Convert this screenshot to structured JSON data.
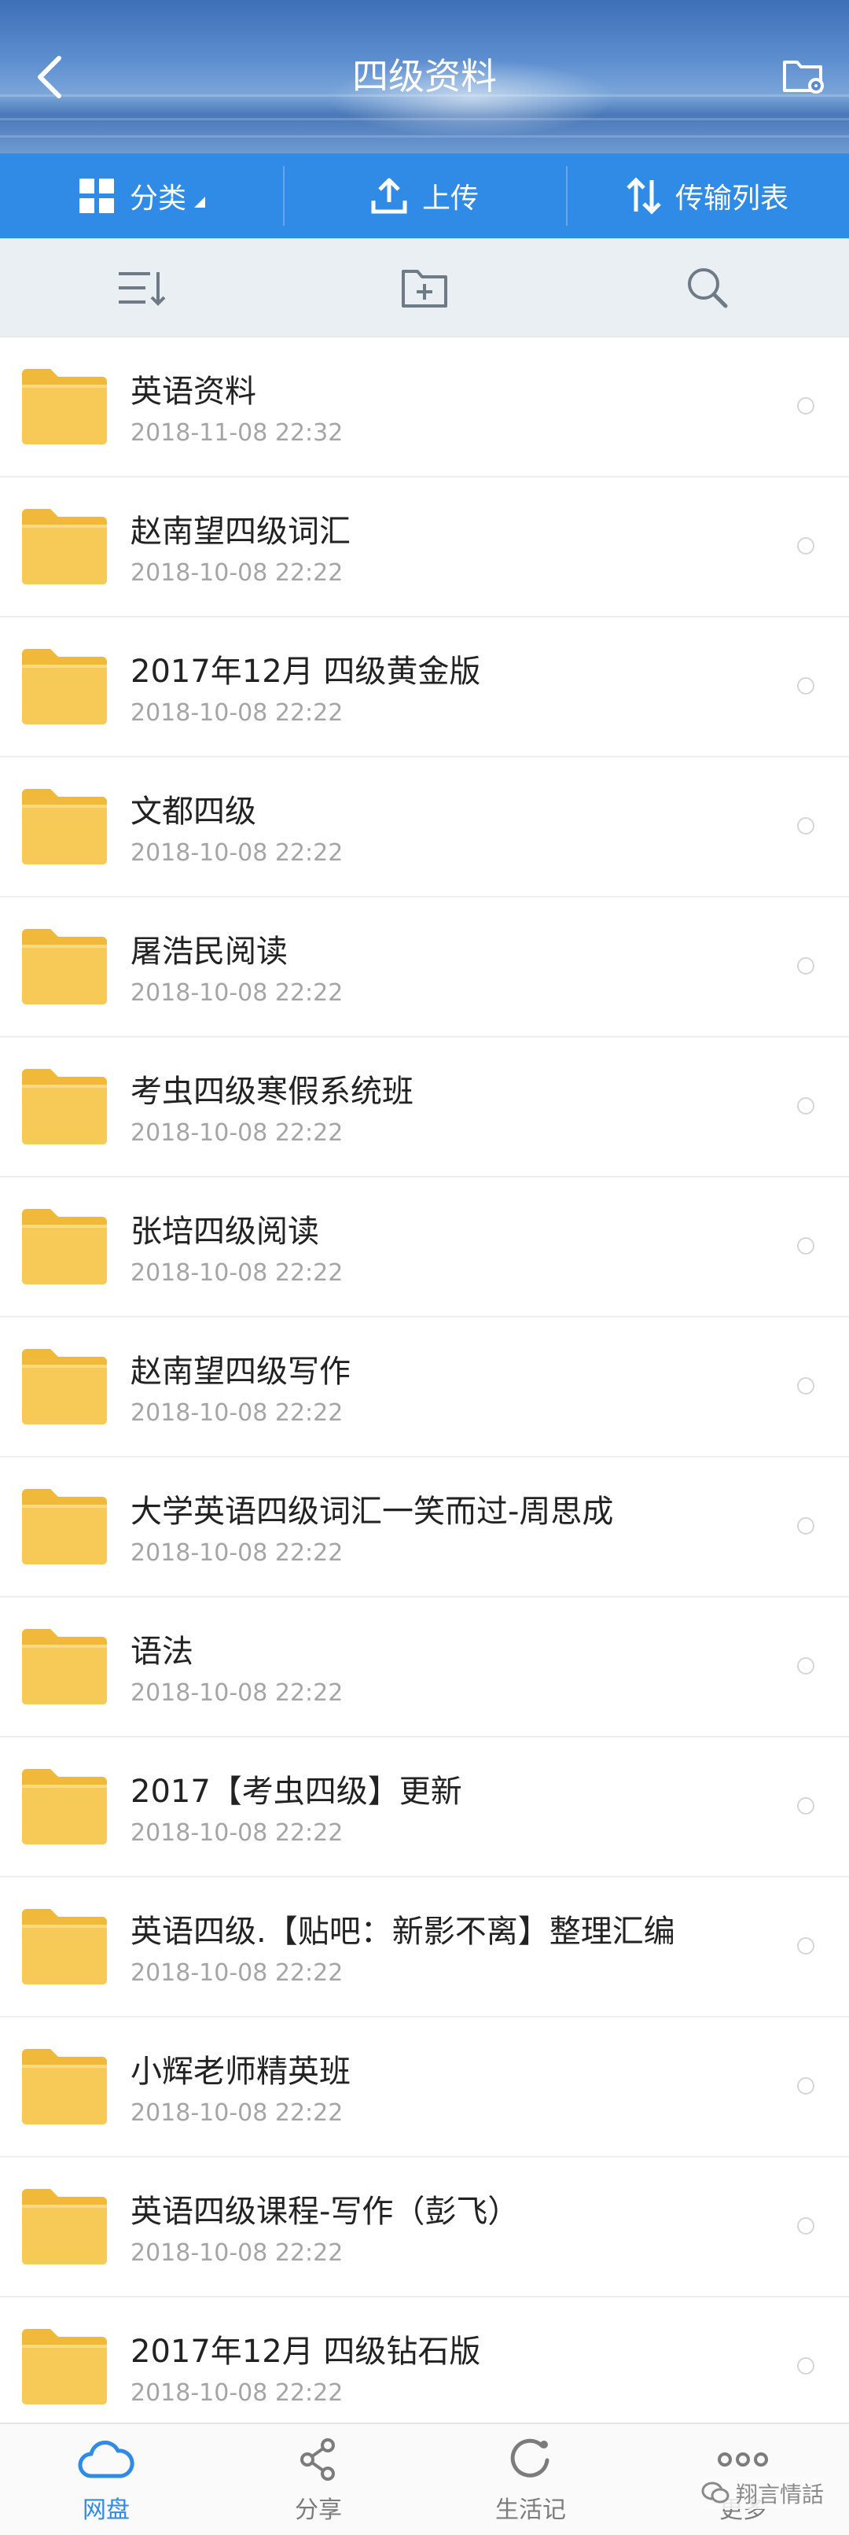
{
  "header": {
    "title": "四级资料",
    "back_icon": "back-arrow-icon",
    "folder_settings_icon": "folder-settings-icon"
  },
  "tabs": [
    {
      "label": "分类",
      "icon": "grid-icon"
    },
    {
      "label": "上传",
      "icon": "upload-icon"
    },
    {
      "label": "传输列表",
      "icon": "transfer-icon"
    }
  ],
  "toolbar": {
    "sort_icon": "sort-icon",
    "new_folder_icon": "new-folder-icon",
    "search_icon": "search-icon"
  },
  "files": [
    {
      "name": "英语资料",
      "date": "2018-11-08  22:32"
    },
    {
      "name": "赵南望四级词汇",
      "date": "2018-10-08  22:22"
    },
    {
      "name": "2017年12月 四级黄金版",
      "date": "2018-10-08  22:22"
    },
    {
      "name": "文都四级",
      "date": "2018-10-08  22:22"
    },
    {
      "name": "屠浩民阅读",
      "date": "2018-10-08  22:22"
    },
    {
      "name": "考虫四级寒假系统班",
      "date": "2018-10-08  22:22"
    },
    {
      "name": "张培四级阅读",
      "date": "2018-10-08  22:22"
    },
    {
      "name": "赵南望四级写作",
      "date": "2018-10-08  22:22"
    },
    {
      "name": "大学英语四级词汇一笑而过-周思成",
      "date": "2018-10-08  22:22"
    },
    {
      "name": "语法",
      "date": "2018-10-08  22:22"
    },
    {
      "name": "2017【考虫四级】更新",
      "date": "2018-10-08  22:22"
    },
    {
      "name": "英语四级.【贴吧：新影不离】整理汇编",
      "date": "2018-10-08  22:22"
    },
    {
      "name": "小辉老师精英班",
      "date": "2018-10-08  22:22"
    },
    {
      "name": "英语四级课程-写作（彭飞）",
      "date": "2018-10-08  22:22"
    },
    {
      "name": "2017年12月 四级钻石版",
      "date": "2018-10-08  22:22"
    }
  ],
  "bottom_nav": [
    {
      "label": "网盘",
      "icon": "cloud-icon",
      "active": true
    },
    {
      "label": "分享",
      "icon": "share-icon",
      "active": false
    },
    {
      "label": "生活记",
      "icon": "refresh-circle-icon",
      "active": false
    },
    {
      "label": "更多",
      "icon": "more-icon",
      "active": false
    }
  ],
  "watermark": {
    "text": "翔言情話"
  },
  "colors": {
    "accent": "#2f8be6",
    "folder": "#f5c44a",
    "toolbar_bg": "#eaeff4",
    "date_text": "#a5a5a5"
  }
}
